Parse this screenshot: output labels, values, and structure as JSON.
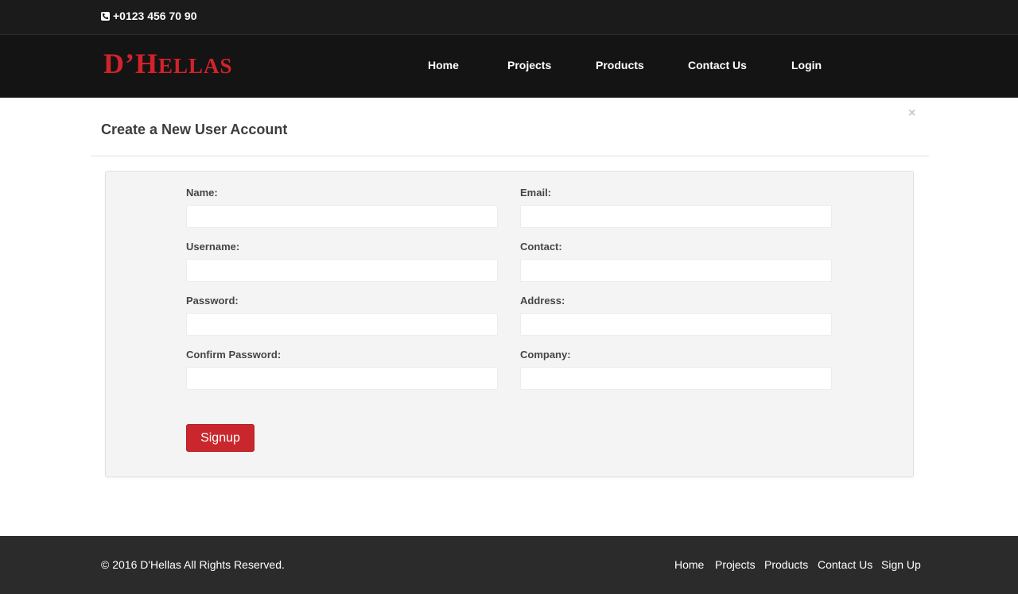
{
  "topbar": {
    "phone": "+0123 456 70 90",
    "phone_icon": "phone-icon"
  },
  "brand": {
    "logo_part1": "D’",
    "logo_part2": "H",
    "logo_part3": "ELLAS",
    "color": "#d2232a"
  },
  "nav": {
    "items": [
      {
        "label": "Home"
      },
      {
        "label": "Projects"
      },
      {
        "label": "Products"
      },
      {
        "label": "Contact Us"
      },
      {
        "label": "Login"
      }
    ]
  },
  "modal": {
    "title": "Create a New User Account",
    "close_label": "×"
  },
  "form": {
    "fields": [
      {
        "label": "Name:",
        "value": ""
      },
      {
        "label": "Email:",
        "value": ""
      },
      {
        "label": "Username:",
        "value": ""
      },
      {
        "label": "Contact:",
        "value": ""
      },
      {
        "label": "Password:",
        "value": ""
      },
      {
        "label": "Address:",
        "value": ""
      },
      {
        "label": "Confirm Password:",
        "value": ""
      },
      {
        "label": "Company:",
        "value": ""
      }
    ],
    "submit_label": "Signup",
    "accent": "#c9272d"
  },
  "footer": {
    "copyright": "© 2016 D'Hellas All Rights Reserved.",
    "links": [
      {
        "label": "Home"
      },
      {
        "label": "Projects"
      },
      {
        "label": "Products"
      },
      {
        "label": "Contact Us"
      },
      {
        "label": "Sign Up"
      }
    ]
  }
}
